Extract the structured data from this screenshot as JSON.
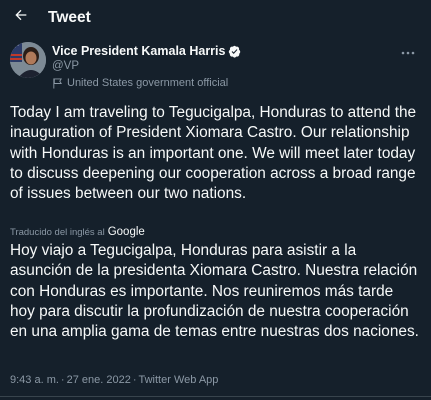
{
  "header": {
    "title": "Tweet",
    "back_icon": "arrow-left-icon"
  },
  "author": {
    "display_name": "Vice President Kamala Harris",
    "handle": "@VP",
    "affiliation": "United States government official",
    "verified_icon": "verified-badge-icon",
    "flag_icon": "government-flag-icon",
    "more_icon": "more-dots-icon"
  },
  "tweet": {
    "text": "Today I am traveling to Tegucigalpa, Honduras to attend the inauguration of President Xiomara Castro. Our relationship with Honduras is an important one. We will meet later today to discuss deepening our cooperation across a broad range of issues between our two nations.",
    "translation_label": "Traducido del inglés al",
    "translation_provider": "Google",
    "translated_text": "Hoy viajo a Tegucigalpa, Honduras para asistir a la asunción de la presidenta Xiomara Castro. Nuestra relación con Honduras es importante. Nos reuniremos más tarde hoy para discutir la profundización de nuestra cooperación en una amplia gama de temas entre nuestras dos naciones."
  },
  "meta": {
    "time": "9:43 a. m.",
    "separator": "·",
    "date": "27 ene. 2022",
    "source": "Twitter Web App"
  },
  "colors": {
    "background": "#15202b",
    "text": "#f7f9f9",
    "secondary": "#8b98a5",
    "verified": "#1d9bf0"
  }
}
